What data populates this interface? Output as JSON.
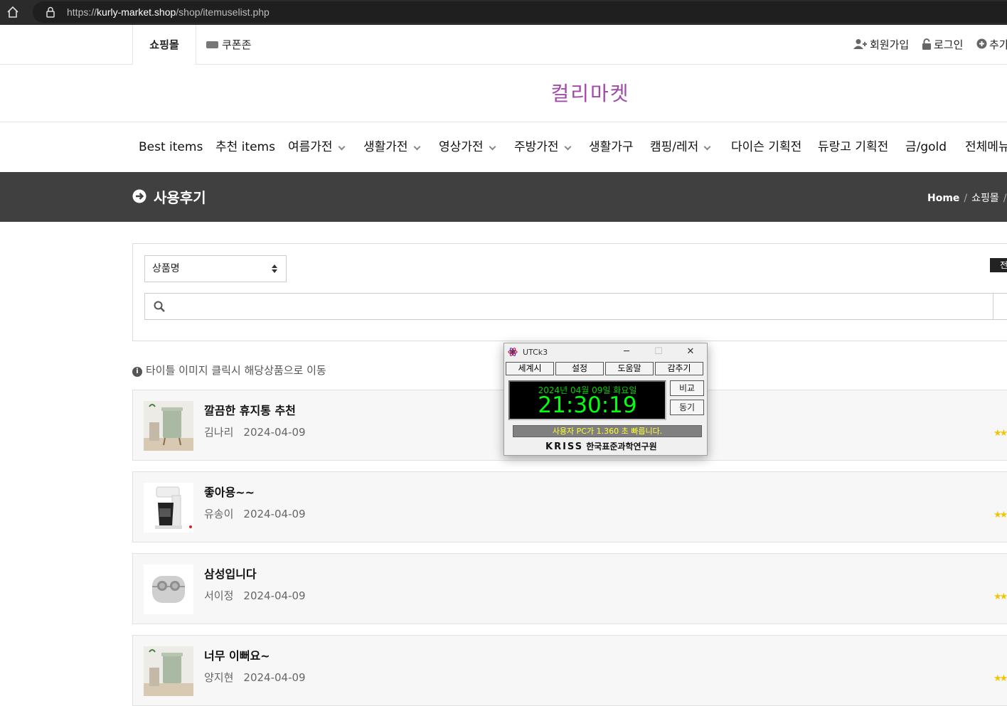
{
  "browser": {
    "url_prefix": "https://",
    "url_domain": "kurly-market.shop",
    "url_path": "/shop/itemuselist.php"
  },
  "top_tabs": {
    "shop": "쇼핑몰",
    "coupon": "쿠폰존",
    "signup": "회원가입",
    "login": "로그인",
    "more": "추가"
  },
  "logo": "컬리마켓",
  "gnb": [
    {
      "label": "Best items",
      "has_sub": false
    },
    {
      "label": "추천 items",
      "has_sub": false
    },
    {
      "label": "여름가전",
      "has_sub": true
    },
    {
      "label": "생활가전",
      "has_sub": true
    },
    {
      "label": "영상가전",
      "has_sub": true
    },
    {
      "label": "주방가전",
      "has_sub": true
    },
    {
      "label": "생활가구",
      "has_sub": false
    },
    {
      "label": "캠핑/레저",
      "has_sub": true
    },
    {
      "label": "다이슨 기획전",
      "has_sub": false
    },
    {
      "label": "듀랑고 기획전",
      "has_sub": false
    },
    {
      "label": "금/gold",
      "has_sub": false
    },
    {
      "label": "전체메뉴",
      "has_sub": false
    }
  ],
  "page_header": {
    "title": "사용후기",
    "breadcrumb_home": "Home",
    "breadcrumb_sep": "/",
    "breadcrumb_shop": "쇼핑몰"
  },
  "search": {
    "select_value": "상품명",
    "sort_label": "전",
    "input_value": ""
  },
  "notice": "타이틀 이미지 클릭시 해당상품으로 이동",
  "reviews": [
    {
      "title": "깔끔한 휴지통 추천",
      "author": "김나리",
      "date": "2024-04-09",
      "thumb": "bin"
    },
    {
      "title": "좋아용~~",
      "author": "유송이",
      "date": "2024-04-09",
      "thumb": "coffee"
    },
    {
      "title": "삼성입니다",
      "author": "서이정",
      "date": "2024-04-09",
      "thumb": "earbuds"
    },
    {
      "title": "너무 이뻐요~",
      "author": "양지현",
      "date": "2024-04-09",
      "thumb": "bin"
    }
  ],
  "utck": {
    "title": "UTCk3",
    "menu": [
      "세계시",
      "설정",
      "도움말",
      "감추기"
    ],
    "date": "2024년 04월 09일 화요일",
    "time": "21:30:19",
    "compare_label": "비교",
    "sync_label": "동기",
    "status": "사용자 PC가 1.360 초 빠릅니다.",
    "org_logo": "KRISS",
    "org_name": "한국표준과학연구원"
  },
  "colors": {
    "logo": "#a14aa7",
    "header_bg": "#404040",
    "clock_green": "#00ff10",
    "star": "#f5c400"
  }
}
